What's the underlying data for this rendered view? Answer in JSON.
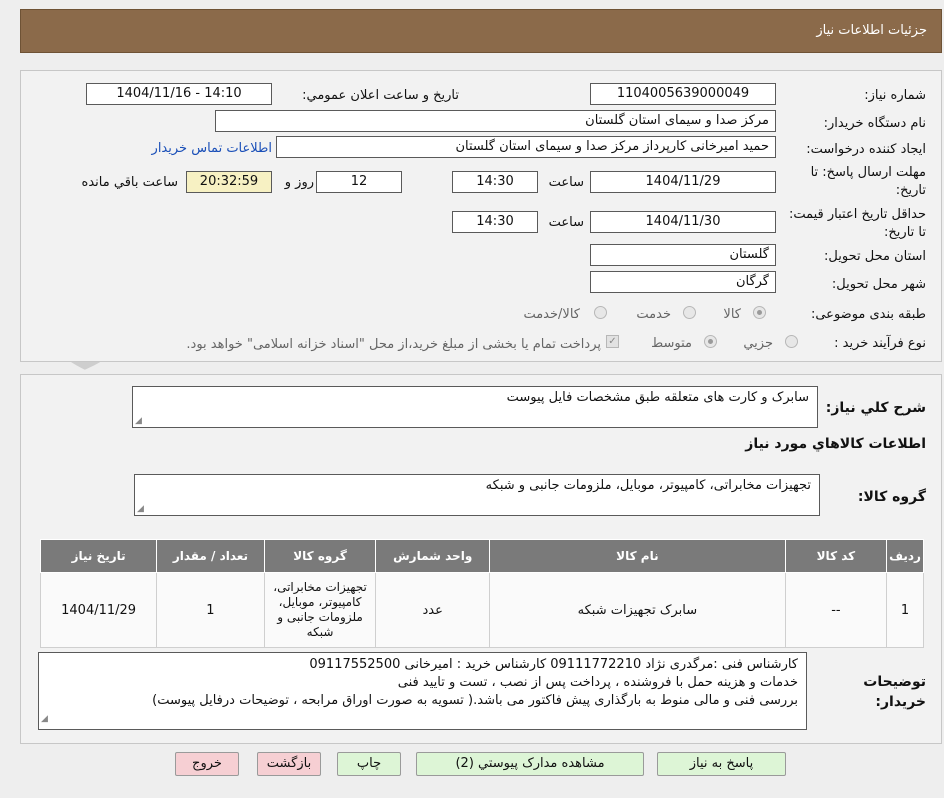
{
  "header": {
    "title": "جزئیات اطلاعات نیاز"
  },
  "form": {
    "need_number_label": "شماره نیاز:",
    "need_number": "1104005639000049",
    "announce_label": "تاریخ و ساعت اعلان عمومي:",
    "announce_value": "1404/11/16 - 14:10",
    "buyer_org_label": "نام دستگاه خريدار:",
    "buyer_org": "مرکز صدا و سیمای استان گلستان",
    "requester_label": "ایجاد کننده درخواست:",
    "requester": "حمید امیرخانی کارپرداز مرکز صدا و سیمای استان گلستان",
    "contact_link": "اطلاعات تماس خريدار",
    "deadline_label": "مهلت ارسال پاسخ: تا تاریخ:",
    "deadline_date": "1404/11/29",
    "time_label": "ساعت",
    "deadline_time": "14:30",
    "days_value": "12",
    "days_label": "روز و",
    "remaining_time": "20:32:59",
    "remaining_label": "ساعت باقي مانده",
    "validity_label": "حداقل تاريخ اعتبار قيمت: تا تاريخ:",
    "validity_date": "1404/11/30",
    "validity_time": "14:30",
    "province_label": "استان محل تحويل:",
    "province": "گلستان",
    "city_label": "شهر محل تحويل:",
    "city": "گرگان",
    "category_label": "طبقه بندی موضوعی:",
    "category_options": [
      "کالا",
      "خدمت",
      "کالا/خدمت"
    ],
    "process_label": "نوع فرآیند خرید :",
    "process_options": [
      "جزیي",
      "متوسط"
    ],
    "payment_note": "پرداخت تمام یا بخشی از مبلغ خرید،از محل \"اسناد خزانه اسلامی\" خواهد بود."
  },
  "summary": {
    "desc_label": "شرح کلي نياز:",
    "desc": "سابرک و کارت های متعلقه طبق مشخصات فایل پیوست",
    "goods_info_title": "اطلاعات کالاهاي مورد نياز",
    "group_label": "گروه کالا:",
    "group_value": "تجهیزات مخابراتی، کامپیوتر، موبایل، ملزومات جانبی و شبکه"
  },
  "table": {
    "headers": [
      "رديف",
      "کد کالا",
      "نام کالا",
      "واحد شمارش",
      "گروه کالا",
      "تعداد / مقدار",
      "تاريخ نياز"
    ],
    "rows": [
      {
        "row": "1",
        "code": "--",
        "name": "سابرک تجهیزات شبکه",
        "unit": "عدد",
        "group": "تجهیزات مخابراتی، کامپیوتر، موبایل، ملزومات جانبی و شبکه",
        "qty": "1",
        "date": "1404/11/29"
      }
    ]
  },
  "buyer_notes": {
    "label": "توضيحات خريدار:",
    "lines": [
      "کارشناس فنی :مرگدری نژاد 09111772210  کارشناس خرید : امیرخانی 09117552500",
      "خدمات و هزینه حمل با فروشنده ،  پرداخت پس از نصب ، تست و تایید فنی",
      "بررسی فنی و مالی منوط به بارگذاری پیش فاکتور می باشد.( تسویه به صورت اوراق مرابحه ، توضیحات درفایل پیوست)"
    ]
  },
  "buttons": {
    "reply": "پاسخ به نياز",
    "attachments": "مشاهده مدارک پيوستي (2)",
    "print": "چاپ",
    "back": "بازگشت",
    "exit": "خروج"
  },
  "colors": {
    "header_bg": "#8b6a4a",
    "link": "#1a4fb8",
    "remaining_bg": "#f7f1c3",
    "table_header_bg": "#7a7a7a"
  }
}
